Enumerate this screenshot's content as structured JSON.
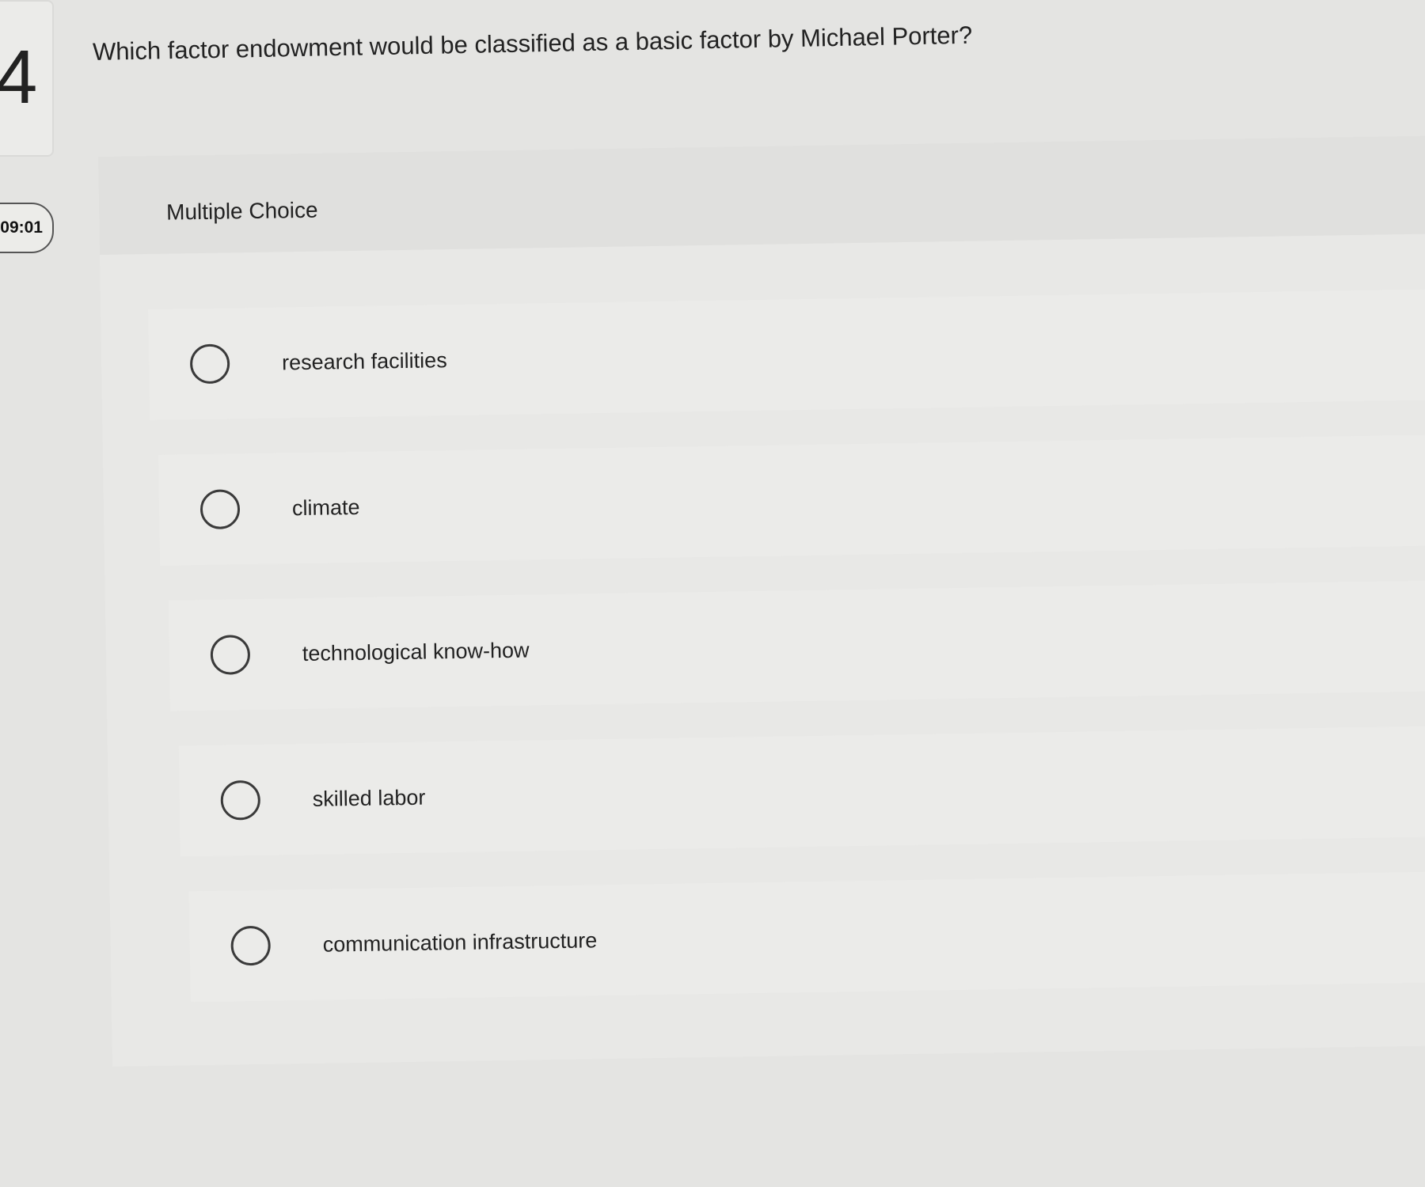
{
  "question": {
    "number": "4",
    "text": "Which factor endowment would be classified as a basic factor by Michael Porter?"
  },
  "timer": {
    "value": "09:01"
  },
  "question_type": {
    "label": "Multiple Choice"
  },
  "options": [
    {
      "label": "research facilities",
      "selected": false
    },
    {
      "label": "climate",
      "selected": false
    },
    {
      "label": "technological know-how",
      "selected": false
    },
    {
      "label": "skilled labor",
      "selected": false
    },
    {
      "label": "communication infrastructure",
      "selected": false
    }
  ]
}
